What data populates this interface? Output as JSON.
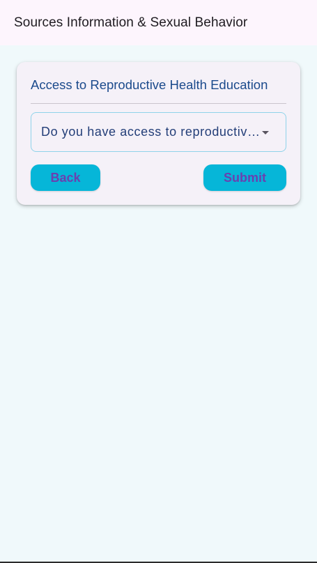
{
  "app_bar": {
    "title": "Sources Information & Sexual Behavior"
  },
  "card": {
    "title": "Access to Reproductive Health Education",
    "question_select": {
      "value": "Do you have access to reproductive health education?"
    },
    "back_label": "Back",
    "submit_label": "Submit"
  },
  "colors": {
    "background": "#f0f9fb",
    "app_bar_bg": "#fdf5fd",
    "card_bg": "#f5f1f8",
    "title_blue": "#1b4a8c",
    "button_cyan": "#06b6d8",
    "button_text": "#6a40b0"
  },
  "icons": {
    "dropdown": "arrow-drop-down-icon"
  }
}
